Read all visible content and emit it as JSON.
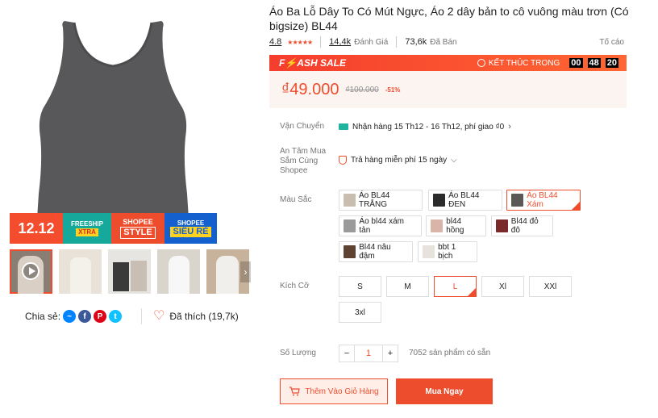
{
  "product": {
    "title": "Áo Ba Lỗ Dây To Có Mút Ngực, Áo 2 dây bản to cô vuông màu trơn (Có bigsize) BL44",
    "rating": "4.8",
    "reviews_count": "14,4k",
    "reviews_label": "Đánh Giá",
    "sold_count": "73,6k",
    "sold_label": "Đã Bán",
    "report_label": "Tố cáo"
  },
  "flash_sale": {
    "label": "F⚡ASH SALE",
    "ends_label": "KẾT THÚC TRONG",
    "hours": "00",
    "minutes": "48",
    "seconds": "20"
  },
  "price": {
    "current": "₫49.000",
    "original": "₫100.000",
    "discount": "-51%"
  },
  "shipping": {
    "label": "Vận Chuyển",
    "text": "Nhận hàng 15 Th12 - 16 Th12, phí giao ₫0"
  },
  "assurance": {
    "label": "An Tâm Mua Sắm Cùng Shopee",
    "text": "Trả hàng miễn phí 15 ngày"
  },
  "color": {
    "label": "Màu Sắc",
    "options": [
      {
        "label": "Áo BL44 TRẮNG",
        "swatch": "#c9bdb0"
      },
      {
        "label": "Áo BL44 ĐEN",
        "swatch": "#2b2b2b"
      },
      {
        "label": "Áo BL44 Xám",
        "swatch": "#5a5956"
      },
      {
        "label": "Áo bl44 xám tản",
        "swatch": "#9a9a9a"
      },
      {
        "label": "bl44 hồng",
        "swatch": "#d8b5a8"
      },
      {
        "label": "Bl44 đỏ đô",
        "swatch": "#7a2a2a"
      },
      {
        "label": "Bl44 nâu đậm",
        "swatch": "#5e4232"
      },
      {
        "label": "bbt 1 bịch",
        "swatch": "#e8e2dc"
      }
    ]
  },
  "size": {
    "label": "Kích Cỡ",
    "options": [
      "S",
      "M",
      "L",
      "Xl",
      "XXl",
      "3xl"
    ]
  },
  "quantity": {
    "label": "Số Lượng",
    "value": "1",
    "minus": "−",
    "plus": "+",
    "stock": "7052 sản phẩm có sẵn"
  },
  "actions": {
    "add_to_cart": "Thêm Vào Giỏ Hàng",
    "buy_now": "Mua Ngay"
  },
  "banner": {
    "event": "12.12",
    "freeship": "FREESHIP",
    "xtra": "XTRA",
    "shopee": "SHOPEE",
    "style": "STYLE",
    "shopee2": "SHOPEE",
    "sieure": "SIÊU RẺ"
  },
  "share": {
    "label": "Chia sẻ:",
    "liked": "Đã thích (19,7k)"
  },
  "colors": {
    "accent": "#ee4d2d",
    "product": "#58585a"
  }
}
